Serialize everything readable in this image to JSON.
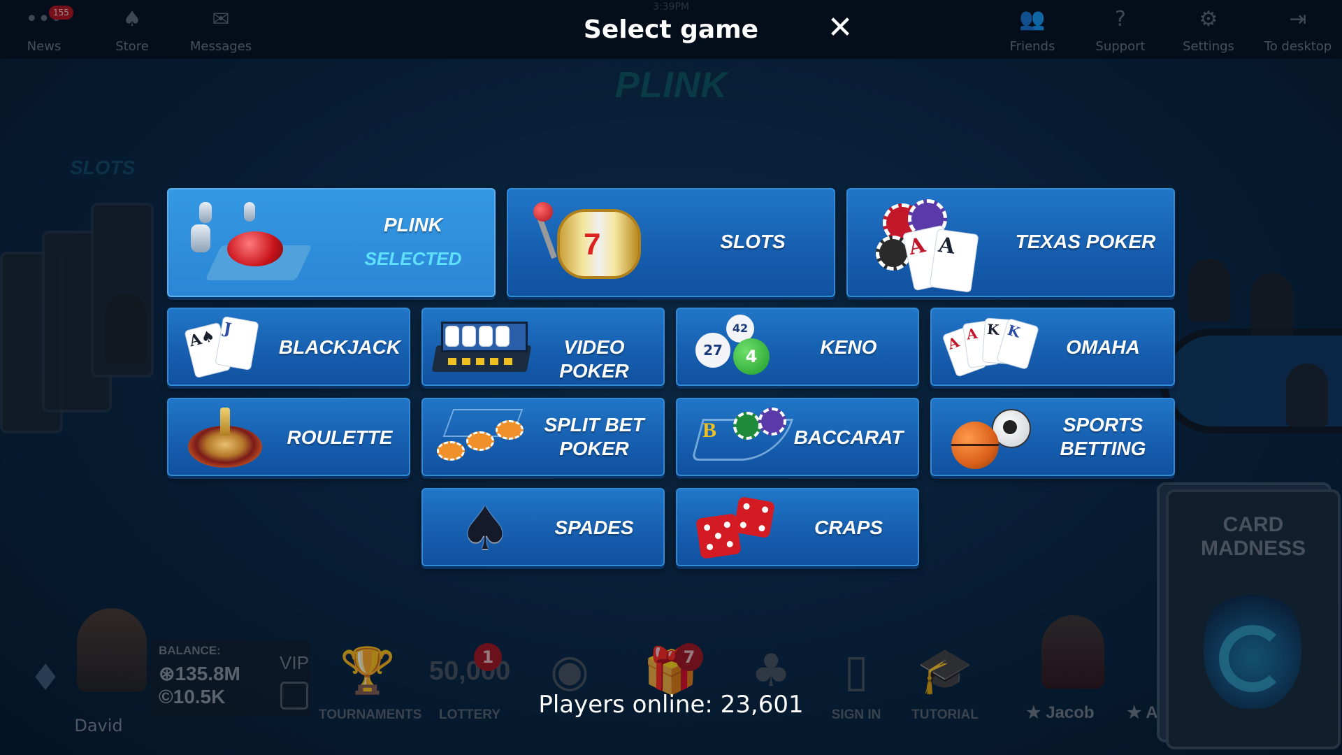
{
  "top_bar": {
    "left_items": [
      {
        "label": "News",
        "icon": "news-icon",
        "badge": "155"
      },
      {
        "label": "Store",
        "icon": "store-icon"
      },
      {
        "label": "Messages",
        "icon": "envelope-icon"
      }
    ],
    "right_items": [
      {
        "label": "Friends",
        "icon": "friends-icon"
      },
      {
        "label": "Support",
        "icon": "question-icon"
      },
      {
        "label": "Settings",
        "icon": "gear-icon"
      },
      {
        "label": "To desktop",
        "icon": "exit-icon"
      }
    ],
    "clock": "3:39PM"
  },
  "background": {
    "current_game_title": "PLINK",
    "slots_label": "SLOTS"
  },
  "modal": {
    "title": "Select game",
    "close_label": "✕",
    "games": [
      {
        "id": "plink",
        "label": "PLINK",
        "status": "SELECTED",
        "selected": true
      },
      {
        "id": "slots",
        "label": "SLOTS"
      },
      {
        "id": "texas-poker",
        "label": "TEXAS POKER"
      },
      {
        "id": "blackjack",
        "label": "BLACKJACK"
      },
      {
        "id": "video-poker",
        "label": "VIDEO POKER"
      },
      {
        "id": "keno",
        "label": "KENO"
      },
      {
        "id": "omaha",
        "label": "OMAHA"
      },
      {
        "id": "roulette",
        "label": "ROULETTE"
      },
      {
        "id": "split-bet-poker",
        "label_line1": "SPLIT BET",
        "label_line2": "POKER"
      },
      {
        "id": "baccarat",
        "label": "BACCARAT"
      },
      {
        "id": "sports-betting",
        "label_line1": "SPORTS",
        "label_line2": "BETTING"
      },
      {
        "id": "spades",
        "label": "SPADES"
      },
      {
        "id": "craps",
        "label": "CRAPS"
      }
    ],
    "keno_balls": [
      "42",
      "27",
      "4"
    ]
  },
  "player": {
    "name": "David",
    "balance_label": "BALANCE:",
    "chips": "⊛135.8M",
    "gold": "©10.5K",
    "vip_label": "VIP"
  },
  "bottom_bar": {
    "items": [
      {
        "label": "TOURNAMENTS",
        "icon": "trophy-icon"
      },
      {
        "label": "LOTTERY",
        "icon": "lottery-icon",
        "badge": "1",
        "overlay": "50,000"
      },
      {
        "label": "",
        "icon": "poker-chip-icon"
      },
      {
        "label": "",
        "icon": "gift-icon",
        "badge": "7"
      },
      {
        "label": "",
        "icon": "clover-icon"
      },
      {
        "label": "SIGN IN",
        "icon": "door-icon"
      },
      {
        "label": "TUTORIAL",
        "icon": "graduation-cap-icon"
      }
    ],
    "friends": [
      "Jacob",
      "A"
    ],
    "players_online": "Players online: 23,601"
  },
  "card_madness": {
    "title": "CARD MADNESS"
  },
  "colors": {
    "tile": "#175fb0",
    "tile_selected": "#2b86d6",
    "selected_text": "#5fe0ff",
    "background": "#0b2a48"
  }
}
